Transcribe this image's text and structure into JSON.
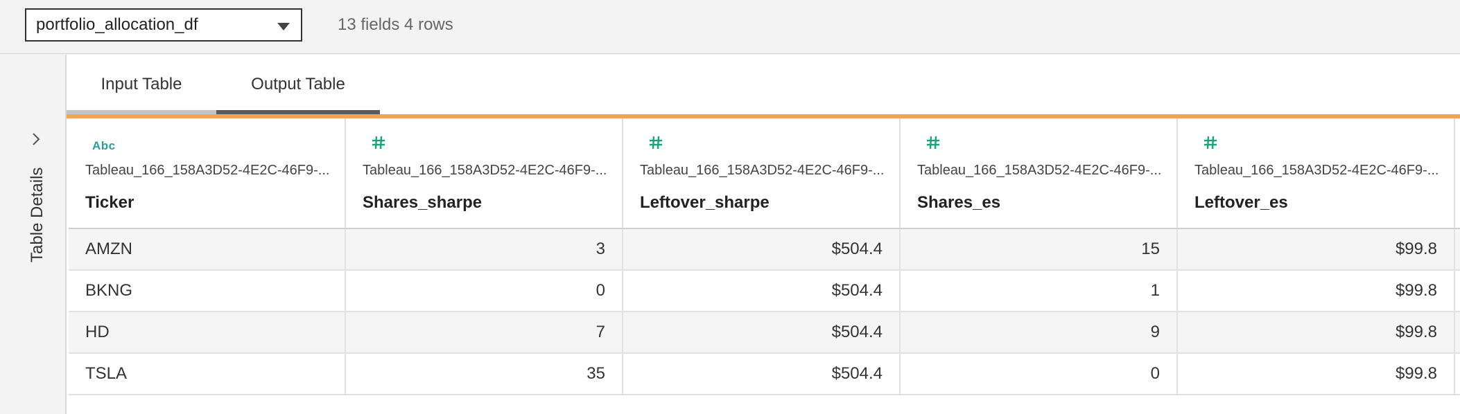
{
  "datasource": {
    "name": "portfolio_allocation_df",
    "meta": "13 fields 4 rows"
  },
  "sidebar": {
    "label": "Table Details"
  },
  "tabs": [
    {
      "label": "Input Table",
      "active": false
    },
    {
      "label": "Output Table",
      "active": true
    }
  ],
  "colors": {
    "accent": "#f0a556",
    "type_icon": "#2a9d9d",
    "active_tab": "#5b5b5b"
  },
  "columns": [
    {
      "type_label": "Abc",
      "type": "string",
      "source": "Tableau_166_158A3D52-4E2C-46F9-...",
      "name": "Ticker"
    },
    {
      "type_label": "#",
      "type": "number",
      "source": "Tableau_166_158A3D52-4E2C-46F9-...",
      "name": "Shares_sharpe"
    },
    {
      "type_label": "#",
      "type": "number",
      "source": "Tableau_166_158A3D52-4E2C-46F9-...",
      "name": "Leftover_sharpe"
    },
    {
      "type_label": "#",
      "type": "number",
      "source": "Tableau_166_158A3D52-4E2C-46F9-...",
      "name": "Shares_es"
    },
    {
      "type_label": "#",
      "type": "number",
      "source": "Tableau_166_158A3D52-4E2C-46F9-...",
      "name": "Leftover_es"
    }
  ],
  "rows": [
    [
      "AMZN",
      "3",
      "$504.4",
      "15",
      "$99.8"
    ],
    [
      "BKNG",
      "0",
      "$504.4",
      "1",
      "$99.8"
    ],
    [
      "HD",
      "7",
      "$504.4",
      "9",
      "$99.8"
    ],
    [
      "TSLA",
      "35",
      "$504.4",
      "0",
      "$99.8"
    ]
  ]
}
